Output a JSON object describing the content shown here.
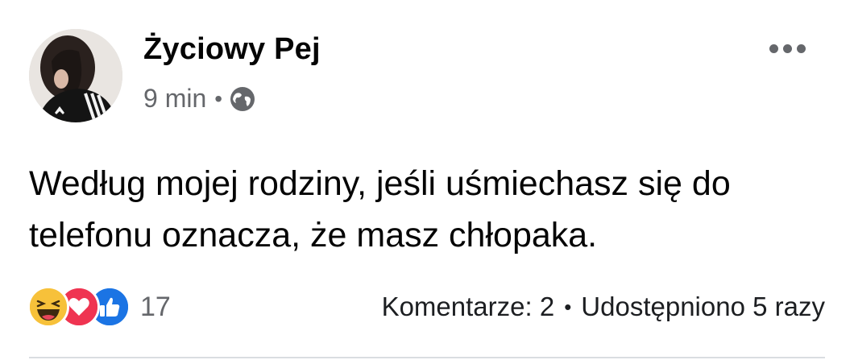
{
  "post": {
    "author_name": "Życiowy Pej",
    "timestamp": "9 min",
    "separator": "•",
    "audience_icon": "globe-icon",
    "text": "Według mojej rodziny, jeśli uśmiechasz się do telefonu oznacza, że masz chłopaka."
  },
  "reactions": {
    "icons": [
      "haha-reaction-icon",
      "love-reaction-icon",
      "like-reaction-icon"
    ],
    "count": "17"
  },
  "stats": {
    "comments": "Komentarze: 2",
    "separator": "•",
    "shares": "Udostępniono 5 razy"
  },
  "colors": {
    "secondary_text": "#65676b",
    "haha": "#f7c13a",
    "love": "#ef3451",
    "like": "#1b74e4"
  }
}
